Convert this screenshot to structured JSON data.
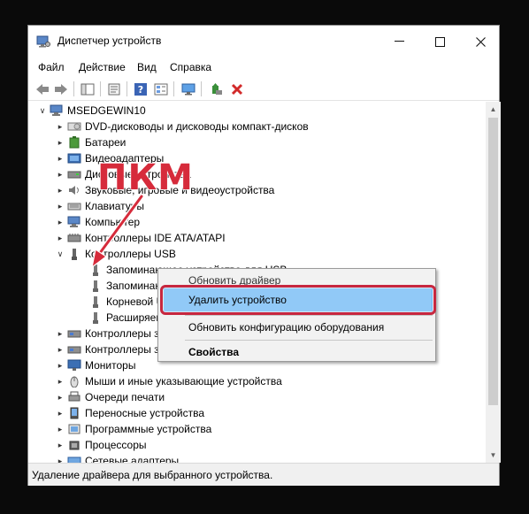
{
  "window": {
    "title": "Диспетчер устройств"
  },
  "menu": [
    "Файл",
    "Действие",
    "Вид",
    "Справка"
  ],
  "tree": {
    "root": "MSEDGEWIN10",
    "items": [
      {
        "label": "DVD-дисководы и дисководы компакт-дисков",
        "icon": "dvd-drive-icon"
      },
      {
        "label": "Батареи",
        "icon": "battery-icon"
      },
      {
        "label": "Видеоадаптеры",
        "icon": "display-adapter-icon"
      },
      {
        "label": "Дисковые устройства",
        "icon": "disk-drive-icon"
      },
      {
        "label": "Звуковые, игровые и видеоустройства",
        "icon": "sound-icon"
      },
      {
        "label": "Клавиатуры",
        "icon": "keyboard-icon"
      },
      {
        "label": "Компьютер",
        "icon": "computer-icon"
      },
      {
        "label": "Контроллеры IDE ATA/ATAPI",
        "icon": "ide-controller-icon"
      },
      {
        "label": "Контроллеры USB",
        "icon": "usb-icon"
      }
    ],
    "usb_children": [
      {
        "label": "Запоминающее устройство для USB"
      },
      {
        "label": "Запоминающее устройство для USB"
      },
      {
        "label": "Корневой USB-концентратор"
      },
      {
        "label": "Расширяемый хост-контроллер"
      }
    ],
    "items_after": [
      {
        "label": "Контроллеры запоминающих устройств",
        "icon": "storage-controller-icon"
      },
      {
        "label": "Контроллеры запоминающих устройств",
        "icon": "storage-controller-icon"
      },
      {
        "label": "Мониторы",
        "icon": "monitor-icon"
      },
      {
        "label": "Мыши и иные указывающие устройства",
        "icon": "mouse-icon"
      },
      {
        "label": "Очереди печати",
        "icon": "printer-icon"
      },
      {
        "label": "Переносные устройства",
        "icon": "portable-device-icon"
      },
      {
        "label": "Программные устройства",
        "icon": "software-device-icon"
      },
      {
        "label": "Процессоры",
        "icon": "processor-icon"
      },
      {
        "label": "Сетевые адаптеры",
        "icon": "network-adapter-icon"
      }
    ]
  },
  "context_menu": {
    "update_driver": "Обновить драйвер",
    "uninstall_device": "Удалить устройство",
    "scan_hardware": "Обновить конфигурацию оборудования",
    "properties": "Свойства"
  },
  "annotation": {
    "text": "ПКМ",
    "color": "#d62b3b"
  },
  "status_bar": "Удаление драйвера для выбранного устройства."
}
